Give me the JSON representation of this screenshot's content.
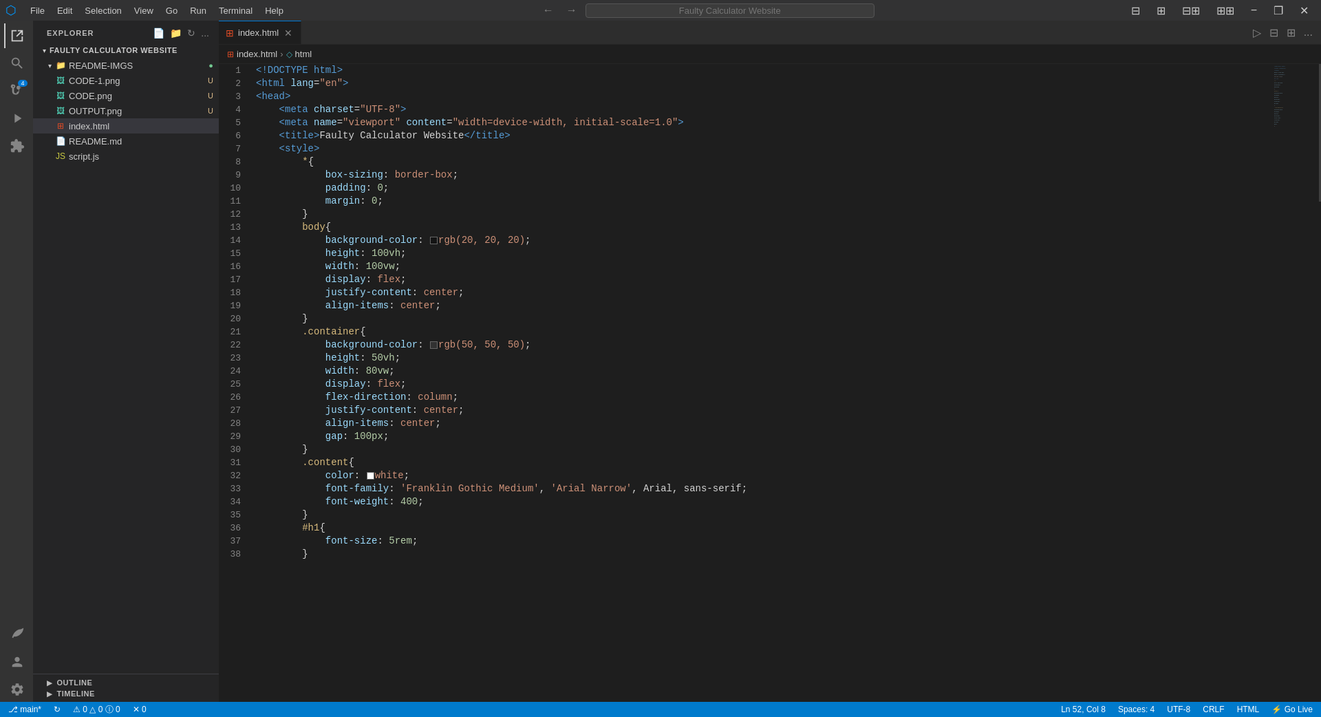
{
  "titleBar": {
    "appIcon": "⬡",
    "menus": [
      "File",
      "Edit",
      "Selection",
      "View",
      "Go",
      "Run",
      "Terminal",
      "Help"
    ],
    "navBack": "←",
    "navForward": "→",
    "searchPlaceholder": "Faulty Calculator Website",
    "winBtnMin": "−",
    "winBtnMax": "❐",
    "winBtnClose": "✕"
  },
  "activityBar": {
    "icons": [
      {
        "name": "explorer-icon",
        "symbol": "⊞",
        "active": true
      },
      {
        "name": "search-icon",
        "symbol": "🔍",
        "active": false
      },
      {
        "name": "source-control-icon",
        "symbol": "⎇",
        "active": false,
        "badge": "4"
      },
      {
        "name": "run-icon",
        "symbol": "▷",
        "active": false
      },
      {
        "name": "extensions-icon",
        "symbol": "⊡",
        "active": false
      }
    ],
    "bottomIcons": [
      {
        "name": "accounts-icon",
        "symbol": "👤"
      },
      {
        "name": "settings-icon",
        "symbol": "⚙"
      }
    ]
  },
  "sidebar": {
    "title": "EXPLORER",
    "moreBtn": "...",
    "project": {
      "name": "FAULTY CALCULATOR WEBSITE",
      "folders": [
        {
          "name": "README-IMGS",
          "expanded": true,
          "badge": "●",
          "badgeColor": "green",
          "files": [
            {
              "name": "CODE-1.png",
              "type": "png",
              "badge": "U"
            },
            {
              "name": "CODE.png",
              "type": "png",
              "badge": "U"
            },
            {
              "name": "OUTPUT.png",
              "type": "png",
              "badge": "U"
            }
          ]
        }
      ],
      "rootFiles": [
        {
          "name": "index.html",
          "type": "html",
          "active": true
        },
        {
          "name": "README.md",
          "type": "md"
        },
        {
          "name": "script.js",
          "type": "js"
        }
      ]
    },
    "panels": [
      {
        "name": "OUTLINE",
        "expanded": false
      },
      {
        "name": "TIMELINE",
        "expanded": false
      }
    ]
  },
  "editor": {
    "tabs": [
      {
        "name": "index.html",
        "type": "html",
        "active": true,
        "modified": false
      }
    ],
    "breadcrumb": [
      "index.html",
      "html"
    ],
    "tabActions": [
      "▷",
      "⊟",
      "⊞",
      "⊞⊞",
      "..."
    ],
    "lines": [
      {
        "num": 1,
        "tokens": [
          {
            "t": "t-blue",
            "v": "<!DOCTYPE "
          },
          {
            "t": "t-blue",
            "v": "html"
          },
          {
            "t": "t-blue",
            "v": ">"
          }
        ]
      },
      {
        "num": 2,
        "tokens": [
          {
            "t": "t-blue",
            "v": "<html"
          },
          {
            "t": "t-attr",
            "v": " lang"
          },
          {
            "t": "t-white",
            "v": "="
          },
          {
            "t": "t-orange",
            "v": "\"en\""
          },
          {
            "t": "t-blue",
            "v": ">"
          }
        ]
      },
      {
        "num": 3,
        "tokens": [
          {
            "t": "t-blue",
            "v": "<head>"
          }
        ]
      },
      {
        "num": 4,
        "tokens": [
          {
            "t": "t-white",
            "v": "    "
          },
          {
            "t": "t-blue",
            "v": "<meta"
          },
          {
            "t": "t-attr",
            "v": " charset"
          },
          {
            "t": "t-white",
            "v": "="
          },
          {
            "t": "t-orange",
            "v": "\"UTF-8\""
          },
          {
            "t": "t-blue",
            "v": ">"
          }
        ]
      },
      {
        "num": 5,
        "tokens": [
          {
            "t": "t-white",
            "v": "    "
          },
          {
            "t": "t-blue",
            "v": "<meta"
          },
          {
            "t": "t-attr",
            "v": " name"
          },
          {
            "t": "t-white",
            "v": "="
          },
          {
            "t": "t-orange",
            "v": "\"viewport\""
          },
          {
            "t": "t-attr",
            "v": " content"
          },
          {
            "t": "t-white",
            "v": "="
          },
          {
            "t": "t-orange",
            "v": "\"width=device-width, initial-scale=1.0\""
          },
          {
            "t": "t-blue",
            "v": ">"
          }
        ]
      },
      {
        "num": 6,
        "tokens": [
          {
            "t": "t-white",
            "v": "    "
          },
          {
            "t": "t-blue",
            "v": "<title>"
          },
          {
            "t": "t-white",
            "v": "Faulty Calculator Website"
          },
          {
            "t": "t-blue",
            "v": "</title>"
          }
        ]
      },
      {
        "num": 7,
        "tokens": [
          {
            "t": "t-white",
            "v": "    "
          },
          {
            "t": "t-blue",
            "v": "<style>"
          }
        ]
      },
      {
        "num": 8,
        "tokens": [
          {
            "t": "t-white",
            "v": "        "
          },
          {
            "t": "t-selector",
            "v": "*"
          },
          {
            "t": "t-white",
            "v": "{"
          }
        ]
      },
      {
        "num": 9,
        "tokens": [
          {
            "t": "t-white",
            "v": "            "
          },
          {
            "t": "t-property",
            "v": "box-sizing"
          },
          {
            "t": "t-white",
            "v": ": "
          },
          {
            "t": "t-value",
            "v": "border-box"
          },
          {
            "t": "t-white",
            "v": ";"
          }
        ]
      },
      {
        "num": 10,
        "tokens": [
          {
            "t": "t-white",
            "v": "            "
          },
          {
            "t": "t-property",
            "v": "padding"
          },
          {
            "t": "t-white",
            "v": ": "
          },
          {
            "t": "t-num",
            "v": "0"
          },
          {
            "t": "t-white",
            "v": ";"
          }
        ]
      },
      {
        "num": 11,
        "tokens": [
          {
            "t": "t-white",
            "v": "            "
          },
          {
            "t": "t-property",
            "v": "margin"
          },
          {
            "t": "t-white",
            "v": ": "
          },
          {
            "t": "t-num",
            "v": "0"
          },
          {
            "t": "t-white",
            "v": ";"
          }
        ]
      },
      {
        "num": 12,
        "tokens": [
          {
            "t": "t-white",
            "v": "        "
          },
          {
            "t": "t-white",
            "v": "}"
          }
        ]
      },
      {
        "num": 13,
        "tokens": [
          {
            "t": "t-white",
            "v": "        "
          },
          {
            "t": "t-selector",
            "v": "body"
          },
          {
            "t": "t-white",
            "v": "{"
          }
        ]
      },
      {
        "num": 14,
        "tokens": [
          {
            "t": "t-white",
            "v": "            "
          },
          {
            "t": "t-property",
            "v": "background-color"
          },
          {
            "t": "t-white",
            "v": ": "
          },
          {
            "t": "t-swatch",
            "v": "rgb(20, 20, 20)",
            "swatch": "#141414"
          },
          {
            "t": "t-white",
            "v": ";"
          }
        ]
      },
      {
        "num": 15,
        "tokens": [
          {
            "t": "t-white",
            "v": "            "
          },
          {
            "t": "t-property",
            "v": "height"
          },
          {
            "t": "t-white",
            "v": ": "
          },
          {
            "t": "t-num",
            "v": "100vh"
          },
          {
            "t": "t-white",
            "v": ";"
          }
        ]
      },
      {
        "num": 16,
        "tokens": [
          {
            "t": "t-white",
            "v": "            "
          },
          {
            "t": "t-property",
            "v": "width"
          },
          {
            "t": "t-white",
            "v": ": "
          },
          {
            "t": "t-num",
            "v": "100vw"
          },
          {
            "t": "t-white",
            "v": ";"
          }
        ]
      },
      {
        "num": 17,
        "tokens": [
          {
            "t": "t-white",
            "v": "            "
          },
          {
            "t": "t-property",
            "v": "display"
          },
          {
            "t": "t-white",
            "v": ": "
          },
          {
            "t": "t-value",
            "v": "flex"
          },
          {
            "t": "t-white",
            "v": ";"
          }
        ]
      },
      {
        "num": 18,
        "tokens": [
          {
            "t": "t-white",
            "v": "            "
          },
          {
            "t": "t-property",
            "v": "justify-content"
          },
          {
            "t": "t-white",
            "v": ": "
          },
          {
            "t": "t-value",
            "v": "center"
          },
          {
            "t": "t-white",
            "v": ";"
          }
        ]
      },
      {
        "num": 19,
        "tokens": [
          {
            "t": "t-white",
            "v": "            "
          },
          {
            "t": "t-property",
            "v": "align-items"
          },
          {
            "t": "t-white",
            "v": ": "
          },
          {
            "t": "t-value",
            "v": "center"
          },
          {
            "t": "t-white",
            "v": ";"
          }
        ]
      },
      {
        "num": 20,
        "tokens": [
          {
            "t": "t-white",
            "v": "        "
          },
          {
            "t": "t-white",
            "v": "}"
          }
        ]
      },
      {
        "num": 21,
        "tokens": [
          {
            "t": "t-white",
            "v": "        "
          },
          {
            "t": "t-selector",
            "v": ".container"
          },
          {
            "t": "t-white",
            "v": "{"
          }
        ]
      },
      {
        "num": 22,
        "tokens": [
          {
            "t": "t-white",
            "v": "            "
          },
          {
            "t": "t-property",
            "v": "background-color"
          },
          {
            "t": "t-white",
            "v": ": "
          },
          {
            "t": "t-swatch",
            "v": "rgb(50, 50, 50)",
            "swatch": "#323232"
          },
          {
            "t": "t-white",
            "v": ";"
          }
        ]
      },
      {
        "num": 23,
        "tokens": [
          {
            "t": "t-white",
            "v": "            "
          },
          {
            "t": "t-property",
            "v": "height"
          },
          {
            "t": "t-white",
            "v": ": "
          },
          {
            "t": "t-num",
            "v": "50vh"
          },
          {
            "t": "t-white",
            "v": ";"
          }
        ]
      },
      {
        "num": 24,
        "tokens": [
          {
            "t": "t-white",
            "v": "            "
          },
          {
            "t": "t-property",
            "v": "width"
          },
          {
            "t": "t-white",
            "v": ": "
          },
          {
            "t": "t-num",
            "v": "80vw"
          },
          {
            "t": "t-white",
            "v": ";"
          }
        ]
      },
      {
        "num": 25,
        "tokens": [
          {
            "t": "t-white",
            "v": "            "
          },
          {
            "t": "t-property",
            "v": "display"
          },
          {
            "t": "t-white",
            "v": ": "
          },
          {
            "t": "t-value",
            "v": "flex"
          },
          {
            "t": "t-white",
            "v": ";"
          }
        ]
      },
      {
        "num": 26,
        "tokens": [
          {
            "t": "t-white",
            "v": "            "
          },
          {
            "t": "t-property",
            "v": "flex-direction"
          },
          {
            "t": "t-white",
            "v": ": "
          },
          {
            "t": "t-value",
            "v": "column"
          },
          {
            "t": "t-white",
            "v": ";"
          }
        ]
      },
      {
        "num": 27,
        "tokens": [
          {
            "t": "t-white",
            "v": "            "
          },
          {
            "t": "t-property",
            "v": "justify-content"
          },
          {
            "t": "t-white",
            "v": ": "
          },
          {
            "t": "t-value",
            "v": "center"
          },
          {
            "t": "t-white",
            "v": ";"
          }
        ]
      },
      {
        "num": 28,
        "tokens": [
          {
            "t": "t-white",
            "v": "            "
          },
          {
            "t": "t-property",
            "v": "align-items"
          },
          {
            "t": "t-white",
            "v": ": "
          },
          {
            "t": "t-value",
            "v": "center"
          },
          {
            "t": "t-white",
            "v": ";"
          }
        ]
      },
      {
        "num": 29,
        "tokens": [
          {
            "t": "t-white",
            "v": "            "
          },
          {
            "t": "t-property",
            "v": "gap"
          },
          {
            "t": "t-white",
            "v": ": "
          },
          {
            "t": "t-num",
            "v": "100px"
          },
          {
            "t": "t-white",
            "v": ";"
          }
        ]
      },
      {
        "num": 30,
        "tokens": [
          {
            "t": "t-white",
            "v": "        "
          },
          {
            "t": "t-white",
            "v": "}"
          }
        ]
      },
      {
        "num": 31,
        "tokens": [
          {
            "t": "t-white",
            "v": "        "
          },
          {
            "t": "t-selector",
            "v": ".content"
          },
          {
            "t": "t-white",
            "v": "{"
          }
        ]
      },
      {
        "num": 32,
        "tokens": [
          {
            "t": "t-white",
            "v": "            "
          },
          {
            "t": "t-property",
            "v": "color"
          },
          {
            "t": "t-white",
            "v": ": "
          },
          {
            "t": "t-swatch",
            "v": "white",
            "swatch": "#ffffff"
          },
          {
            "t": "t-white",
            "v": ";"
          }
        ]
      },
      {
        "num": 33,
        "tokens": [
          {
            "t": "t-white",
            "v": "            "
          },
          {
            "t": "t-property",
            "v": "font-family"
          },
          {
            "t": "t-white",
            "v": ": "
          },
          {
            "t": "t-orange",
            "v": "'Franklin Gothic Medium'"
          },
          {
            "t": "t-white",
            "v": ", "
          },
          {
            "t": "t-orange",
            "v": "'Arial Narrow'"
          },
          {
            "t": "t-white",
            "v": ", Arial, sans-serif"
          },
          {
            "t": "t-white",
            "v": ";"
          }
        ]
      },
      {
        "num": 34,
        "tokens": [
          {
            "t": "t-white",
            "v": "            "
          },
          {
            "t": "t-property",
            "v": "font-weight"
          },
          {
            "t": "t-white",
            "v": ": "
          },
          {
            "t": "t-num",
            "v": "400"
          },
          {
            "t": "t-white",
            "v": ";"
          }
        ]
      },
      {
        "num": 35,
        "tokens": [
          {
            "t": "t-white",
            "v": "        "
          },
          {
            "t": "t-white",
            "v": "}"
          }
        ]
      },
      {
        "num": 36,
        "tokens": [
          {
            "t": "t-white",
            "v": "        "
          },
          {
            "t": "t-selector",
            "v": "#h1"
          },
          {
            "t": "t-white",
            "v": "{"
          }
        ]
      },
      {
        "num": 37,
        "tokens": [
          {
            "t": "t-white",
            "v": "            "
          },
          {
            "t": "t-property",
            "v": "font-size"
          },
          {
            "t": "t-white",
            "v": ": "
          },
          {
            "t": "t-num",
            "v": "5rem"
          },
          {
            "t": "t-white",
            "v": ";"
          }
        ]
      },
      {
        "num": 38,
        "tokens": [
          {
            "t": "t-white",
            "v": "        "
          },
          {
            "t": "t-white",
            "v": "}"
          }
        ]
      }
    ]
  },
  "statusBar": {
    "left": [
      {
        "label": "⎇ main*",
        "name": "git-branch"
      },
      {
        "label": "↻",
        "name": "sync-icon"
      },
      {
        "label": "⚠ 0 △ 0  Ⓘ 0",
        "name": "problems"
      },
      {
        "label": "✕ 0",
        "name": "errors"
      }
    ],
    "right": [
      {
        "label": "Ln 52, Col 8",
        "name": "cursor-pos"
      },
      {
        "label": "Spaces: 4",
        "name": "indent"
      },
      {
        "label": "UTF-8",
        "name": "encoding"
      },
      {
        "label": "CRLF",
        "name": "line-ending"
      },
      {
        "label": "HTML",
        "name": "language"
      },
      {
        "label": "⚡ Go Live",
        "name": "go-live"
      }
    ]
  }
}
